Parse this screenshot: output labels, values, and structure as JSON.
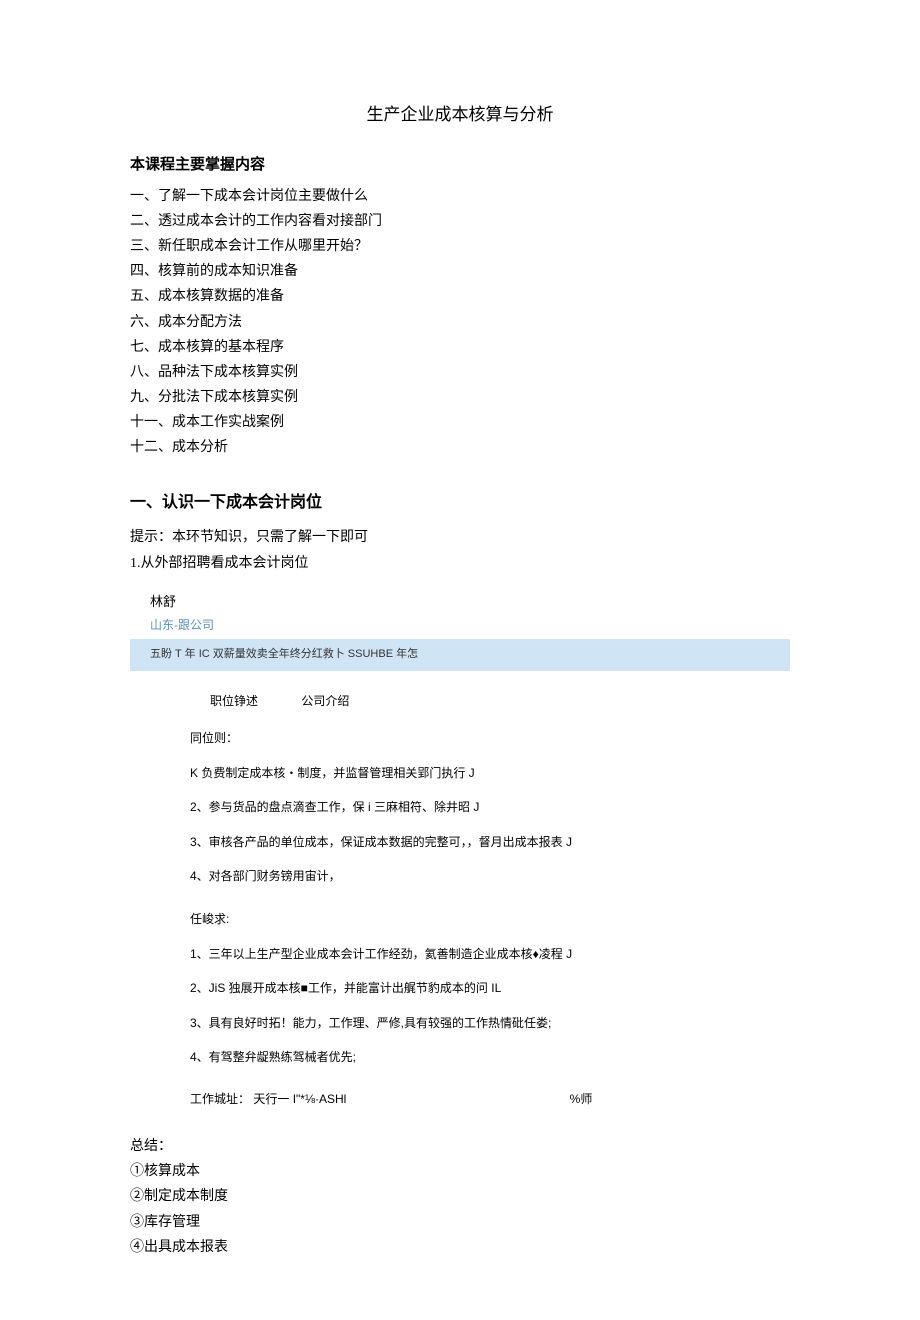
{
  "title": "生产企业成本核算与分析",
  "heading1": "本课程主要掌握内容",
  "toc": [
    "一、了解一下成本会计岗位主要做什么",
    "二、透过成本会计的工作内容看对接部门",
    "三、新任职成本会计工作从哪里开始？",
    "四、核算前的成本知识准备",
    "五、成本核算数据的准备",
    "六、成本分配方法",
    "七、成本核算的基本程序",
    "八、品种法下成本核算实例",
    "九、分批法下成本核算实例",
    "十一、成本工作实战案例",
    "十二、成本分析"
  ],
  "section1": {
    "heading": "一、认识一下成本会计岗位",
    "tip": "提示：本环节知识，只需了解一下即可",
    "sub1": "1.从外部招聘看成本会计岗位"
  },
  "job": {
    "name": "林舒",
    "company": "山东-跟公司",
    "band": "五盼 T 年 IC 双薪量效卖全年终分红救卜 SSUHBE 年怎",
    "tabs": {
      "t1": "职位铮述",
      "t2": "公司介绍"
    },
    "respLabel": "同位则：",
    "resps": [
      "K 负费制定成本核・制度，并监督管理相关郢门执行 J",
      "2、参与货品的盘点滴查工作，保 i 三麻相符、除井昭 J",
      "3、审核各产品的单位成本，保证成本数据的完整可，，督月出成本报表 J",
      "4、对各部门财务镑用宙计，"
    ],
    "reqLabel": "任峻求:",
    "reqs": [
      "1、三年以上生产型企业成本会计工作经劲，氦善制造企业成本核♦凌程 J",
      "2、JiS 独展开成本核■工作，并能富计出艉节豹成本的问 IL",
      "3、具有良好时拓！能力，工作理、严修,具有较强的工作热情砒任娄;",
      "4、有驾整弁龊熟练驾械者优先;"
    ],
    "addressLabel": "工作城址：",
    "addressValue": "天行一 I\"*⅛·ASHl",
    "addressRight": "%师"
  },
  "summary": {
    "heading": "总结：",
    "items": [
      "①核算成本",
      "②制定成本制度",
      "③库存管理",
      "④出具成本报表"
    ]
  }
}
